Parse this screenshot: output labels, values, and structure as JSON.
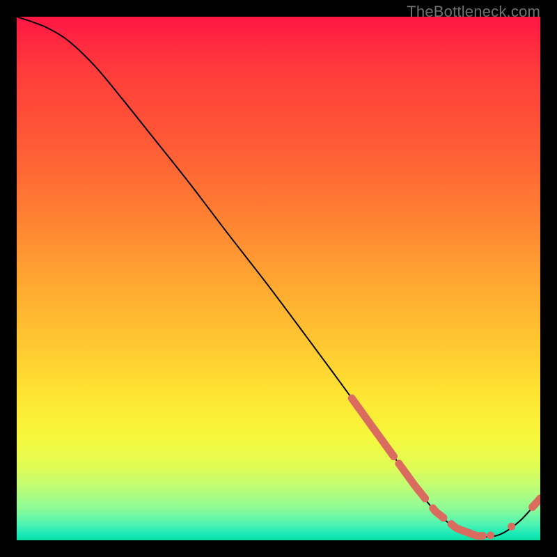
{
  "watermark": "TheBottleneck.com",
  "chart_data": {
    "type": "line",
    "title": "",
    "xlabel": "",
    "ylabel": "",
    "xlim": [
      0,
      100
    ],
    "ylim": [
      0,
      100
    ],
    "background_gradient": {
      "stops": [
        {
          "color": "#ff1744",
          "pos": 0.0
        },
        {
          "color": "#ff3b3b",
          "pos": 0.1
        },
        {
          "color": "#ff5a36",
          "pos": 0.24
        },
        {
          "color": "#ff7a33",
          "pos": 0.36
        },
        {
          "color": "#ffa531",
          "pos": 0.5
        },
        {
          "color": "#ffc631",
          "pos": 0.62
        },
        {
          "color": "#ffe433",
          "pos": 0.72
        },
        {
          "color": "#f7f73b",
          "pos": 0.8
        },
        {
          "color": "#e0fc55",
          "pos": 0.86
        },
        {
          "color": "#bdfd77",
          "pos": 0.9
        },
        {
          "color": "#8cfb98",
          "pos": 0.94
        },
        {
          "color": "#4cf3b2",
          "pos": 0.97
        },
        {
          "color": "#17e8b7",
          "pos": 0.99
        },
        {
          "color": "#0adf9f",
          "pos": 1.0
        }
      ]
    },
    "series": [
      {
        "name": "curve",
        "x": [
          0,
          3,
          6,
          10,
          15,
          20,
          26,
          33,
          40,
          48,
          56,
          63,
          70,
          76,
          80,
          84,
          88,
          92,
          96,
          100
        ],
        "y": [
          100,
          99,
          97.8,
          95.3,
          90.5,
          84.5,
          77.0,
          68.2,
          59.0,
          48.7,
          38.0,
          28.5,
          18.8,
          10.5,
          5.5,
          2.3,
          0.8,
          1.0,
          3.6,
          8.0
        ]
      }
    ],
    "markers": {
      "name": "marker-runs",
      "color": "#d96c5f",
      "runs": [
        {
          "x_start": 64,
          "x_end": 72,
          "type": "solid"
        },
        {
          "x_start": 73,
          "x_end": 78,
          "type": "solid"
        },
        {
          "x_start": 79.5,
          "x_end": 81.5,
          "type": "solid"
        },
        {
          "x_start": 83,
          "x_end": 89,
          "type": "solid"
        },
        {
          "x_start": 90,
          "x_end": 91,
          "type": "dot"
        },
        {
          "x_start": 94,
          "x_end": 95,
          "type": "dot"
        },
        {
          "x_start": 98.5,
          "x_end": 100,
          "type": "solid"
        }
      ]
    }
  }
}
